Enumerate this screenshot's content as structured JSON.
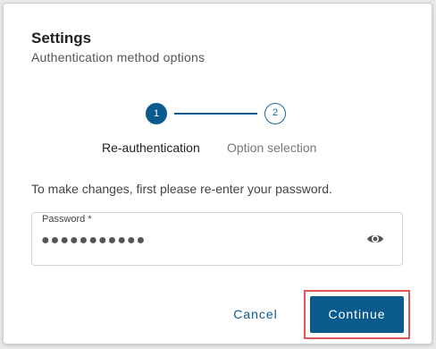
{
  "dialog": {
    "title": "Settings",
    "subtitle": "Authentication method options"
  },
  "stepper": {
    "steps": [
      {
        "number": "1",
        "label": "Re-authentication",
        "state": "active"
      },
      {
        "number": "2",
        "label": "Option selection",
        "state": "pending"
      }
    ]
  },
  "instructions": "To make changes, first please re-enter your password.",
  "password_field": {
    "label": "Password *",
    "value": "●●●●●●●●●●●",
    "toggle_icon": "eye-icon"
  },
  "actions": {
    "cancel_label": "Cancel",
    "continue_label": "Continue"
  },
  "colors": {
    "primary": "#0b5a8e",
    "highlight": "#e05555"
  }
}
